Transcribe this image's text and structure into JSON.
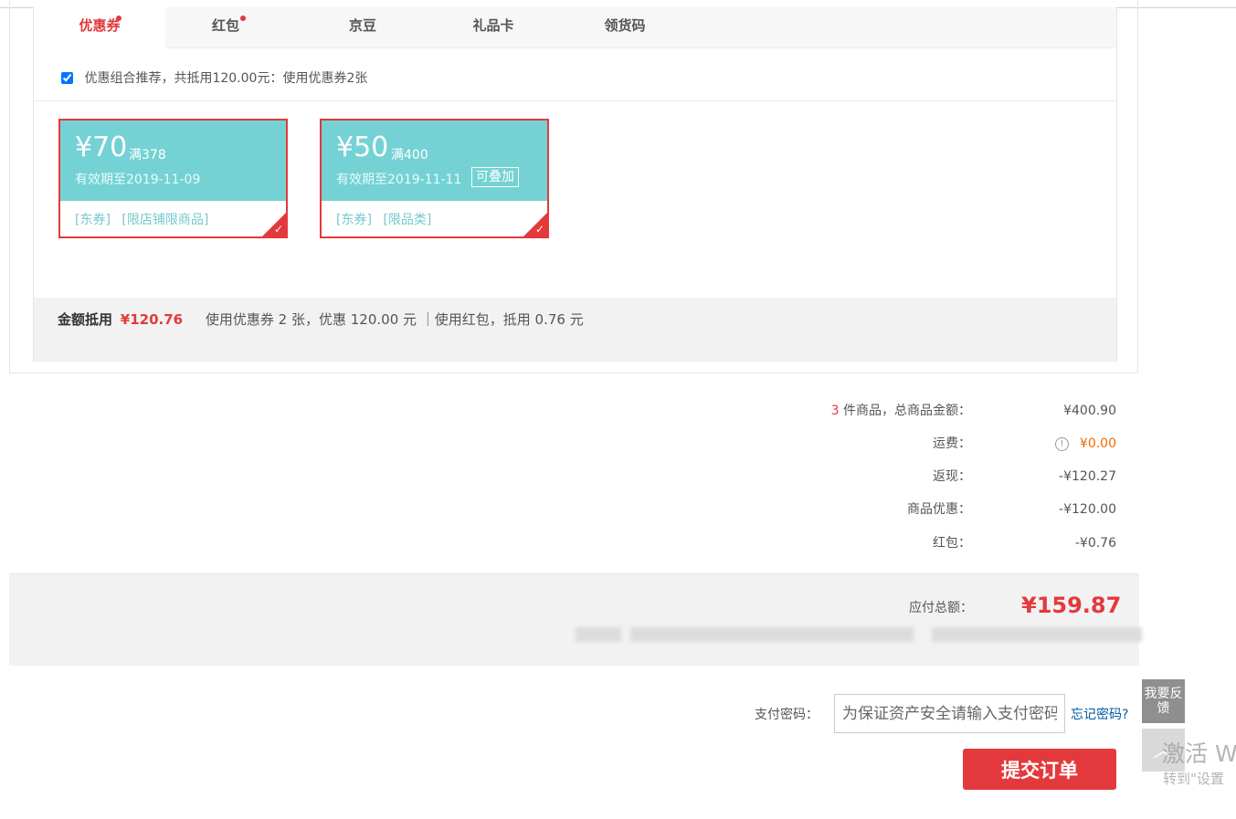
{
  "tabs": [
    {
      "label": "优惠券",
      "active": true,
      "dot": true
    },
    {
      "label": "红包",
      "active": false,
      "dot": true
    },
    {
      "label": "京豆",
      "active": false,
      "dot": false
    },
    {
      "label": "礼品卡",
      "active": false,
      "dot": false
    },
    {
      "label": "领货码",
      "active": false,
      "dot": false
    }
  ],
  "combo": {
    "checked": true,
    "text": "优惠组合推荐，共抵用120.00元：使用优惠券2张"
  },
  "coupons": [
    {
      "price": "¥70",
      "condition": "满378",
      "valid": "有效期至2019-11-09",
      "stack_label": "",
      "tags": [
        "[东券]",
        "[限店铺限商品]"
      ],
      "selected": true
    },
    {
      "price": "¥50",
      "condition": "满400",
      "valid": "有效期至2019-11-11",
      "stack_label": "可叠加",
      "tags": [
        "[东券]",
        "[限品类]"
      ],
      "selected": true
    }
  ],
  "summary": {
    "label": "金额抵用",
    "amount": "¥120.76",
    "detail": "使用优惠券 2 张，优惠 120.00 元 ｜使用红包，抵用 0.76 元"
  },
  "totals": {
    "count": "3",
    "goods_label": " 件商品，总商品金额：",
    "goods_value": "¥400.90",
    "shipping_label": "运费：",
    "shipping_value": "¥0.00",
    "cashback_label": "返现：",
    "cashback_value": "-¥120.27",
    "discount_label": "商品优惠：",
    "discount_value": "-¥120.00",
    "redpacket_label": "红包：",
    "redpacket_value": "-¥0.76"
  },
  "payable": {
    "label": "应付总额：",
    "amount": "¥159.87"
  },
  "password": {
    "label": "支付密码：",
    "placeholder": "为保证资产安全请输入支付密码",
    "forgot": "忘记密码?"
  },
  "submit_label": "提交订单",
  "side": {
    "feedback": "我要反馈"
  },
  "watermark": {
    "line1": "激活 W",
    "line2": "转到\"设置"
  },
  "colors": {
    "accent_red": "#e4393c",
    "coupon_teal": "#74d2d4",
    "link_blue": "#005aa0",
    "shipping_orange": "#f26b00"
  },
  "icons": {
    "check": "checkmark-icon",
    "info": "info-circle-icon",
    "up": "chevron-up-icon"
  }
}
